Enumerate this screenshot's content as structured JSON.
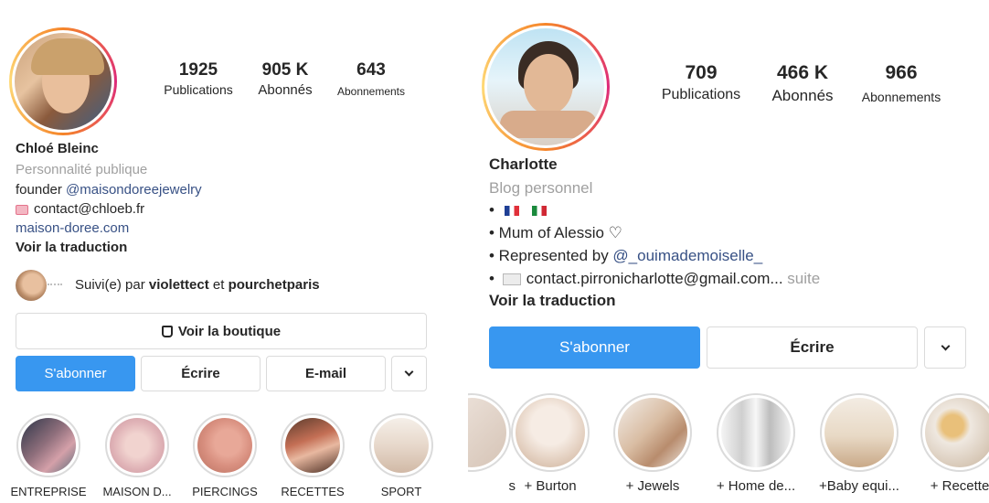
{
  "left": {
    "username": "Chloé Bleinc",
    "category": "Personnalité publique",
    "bio_founder_prefix": "founder ",
    "bio_founder_link": "@maisondoreejewelry",
    "bio_contact": "contact@chloeb.fr",
    "website": "maison-doree.com",
    "translate": "Voir la traduction",
    "stats": [
      {
        "value": "1925",
        "label": "Publications"
      },
      {
        "value": "905 K",
        "label": "Abonnés"
      },
      {
        "value": "643",
        "label": "Abonnements"
      }
    ],
    "followed_by": {
      "prefix": "Suivi(e) par ",
      "user1": "violettect",
      "joiner": " et ",
      "user2": "pourchetparis"
    },
    "shop_button": "Voir la boutique",
    "follow_button": "S'abonner",
    "message_button": "Écrire",
    "email_button": "E-mail",
    "highlights": [
      "ENTREPRISE",
      "MAISON D...",
      "PIERCINGS",
      "RECETTES",
      "SPORT"
    ]
  },
  "right": {
    "username": "Charlotte",
    "category": "Blog personnel",
    "bio_bullet": "•",
    "bio_line2": "• Mum of Alessio ♡",
    "bio_line3_prefix": "• Represented by ",
    "bio_line3_link": "@_ouimademoiselle_",
    "bio_line4": "contact.pirronicharlotte@gmail.com...",
    "bio_more": "suite",
    "translate": "Voir la traduction",
    "stats": [
      {
        "value": "709",
        "label": "Publications"
      },
      {
        "value": "466 K",
        "label": "Abonnés"
      },
      {
        "value": "966",
        "label": "Abonnements"
      }
    ],
    "follow_button": "S'abonner",
    "message_button": "Écrire",
    "highlight_partial": "s",
    "highlights": [
      "+ Burton",
      "+ Jewels",
      "+ Home de...",
      "+Baby equi...",
      "+ Recette"
    ]
  },
  "colors": {
    "primary_button": "#3897f0",
    "link": "#385185",
    "muted_text": "#a0a0a0"
  }
}
